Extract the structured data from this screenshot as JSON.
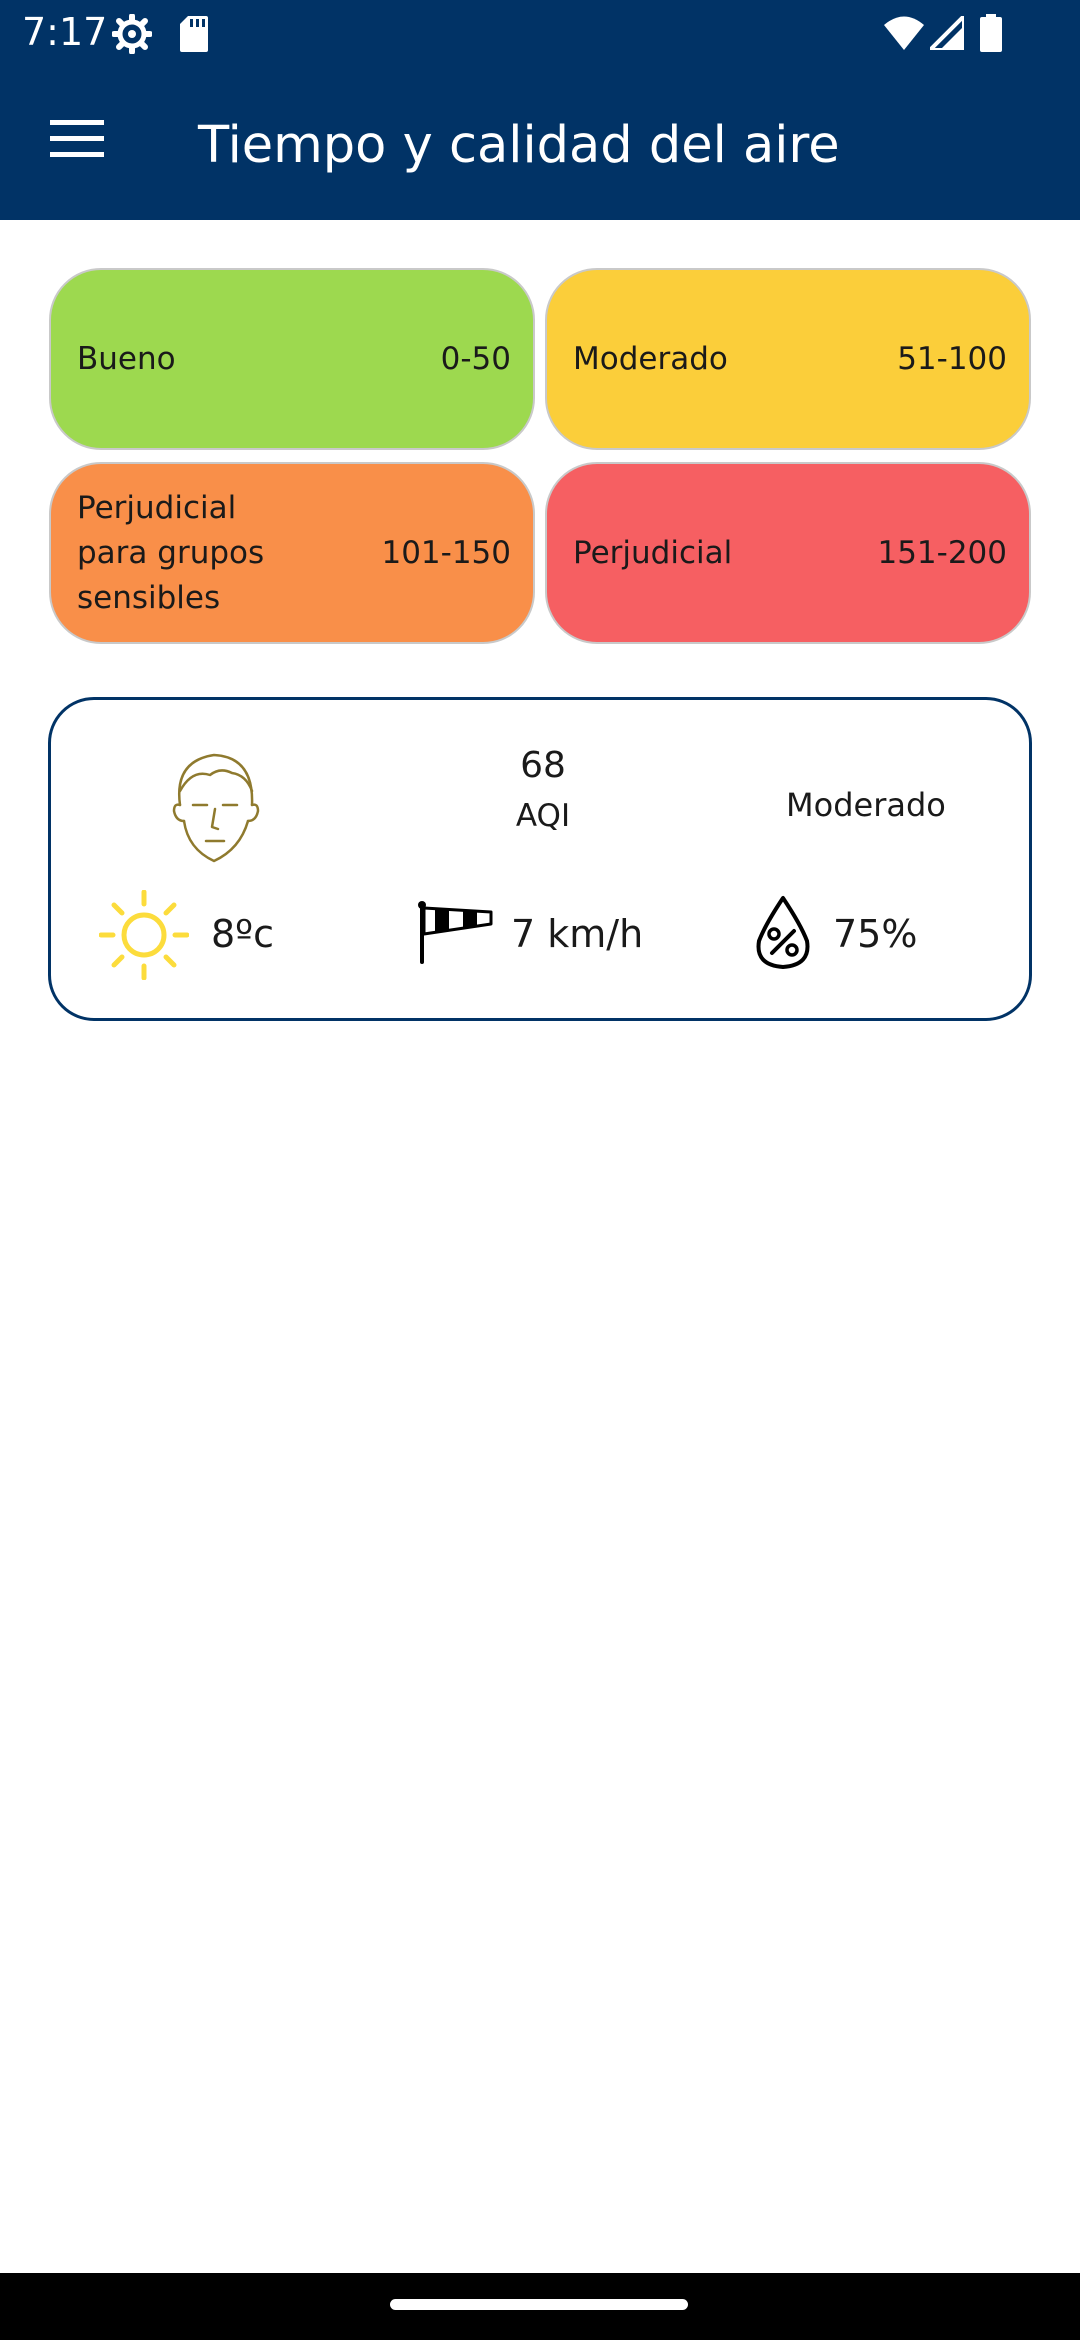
{
  "status_bar": {
    "time": "7:17",
    "icons": [
      "settings-icon",
      "sd-card-icon",
      "wifi-icon",
      "signal-icon",
      "battery-icon"
    ]
  },
  "app_bar": {
    "title": "Tiempo y calidad del aire",
    "menu_icon": "hamburger-menu-icon"
  },
  "legend": [
    {
      "label": "Bueno",
      "range": "0-50",
      "color": "#9dd94f"
    },
    {
      "label": "Moderado",
      "range": "51-100",
      "color": "#fbce3a"
    },
    {
      "label": "Perjudicial para grupos sensibles",
      "range": "101-150",
      "color": "#f98f49"
    },
    {
      "label": "Perjudicial",
      "range": "151-200",
      "color": "#f65f62"
    }
  ],
  "summary": {
    "face_icon": "face-icon",
    "aqi_value": "68",
    "aqi_label": "AQI",
    "category": "Moderado",
    "temperature": "8ºc",
    "temperature_icon": "sun-icon",
    "wind": "7 km/h",
    "wind_icon": "windsock-icon",
    "humidity": "75%",
    "humidity_icon": "humidity-drop-icon"
  },
  "colors": {
    "header": "#013366",
    "card_border": "#013366",
    "sun": "#fcdc3c",
    "face": "#8f7a2e"
  }
}
